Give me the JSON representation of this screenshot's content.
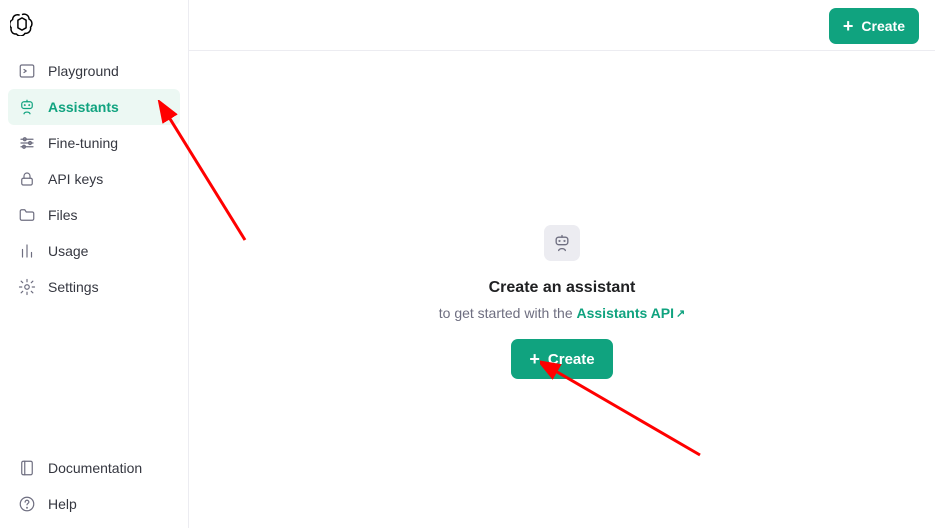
{
  "colors": {
    "accent": "#10a37f"
  },
  "sidebar": {
    "items": [
      {
        "label": "Playground"
      },
      {
        "label": "Assistants"
      },
      {
        "label": "Fine-tuning"
      },
      {
        "label": "API keys"
      },
      {
        "label": "Files"
      },
      {
        "label": "Usage"
      },
      {
        "label": "Settings"
      }
    ],
    "bottom": [
      {
        "label": "Documentation"
      },
      {
        "label": "Help"
      }
    ]
  },
  "topbar": {
    "create_label": "Create"
  },
  "empty_state": {
    "heading": "Create an assistant",
    "sub_prefix": "to get started with the ",
    "link_text": "Assistants API",
    "create_label": "Create"
  }
}
